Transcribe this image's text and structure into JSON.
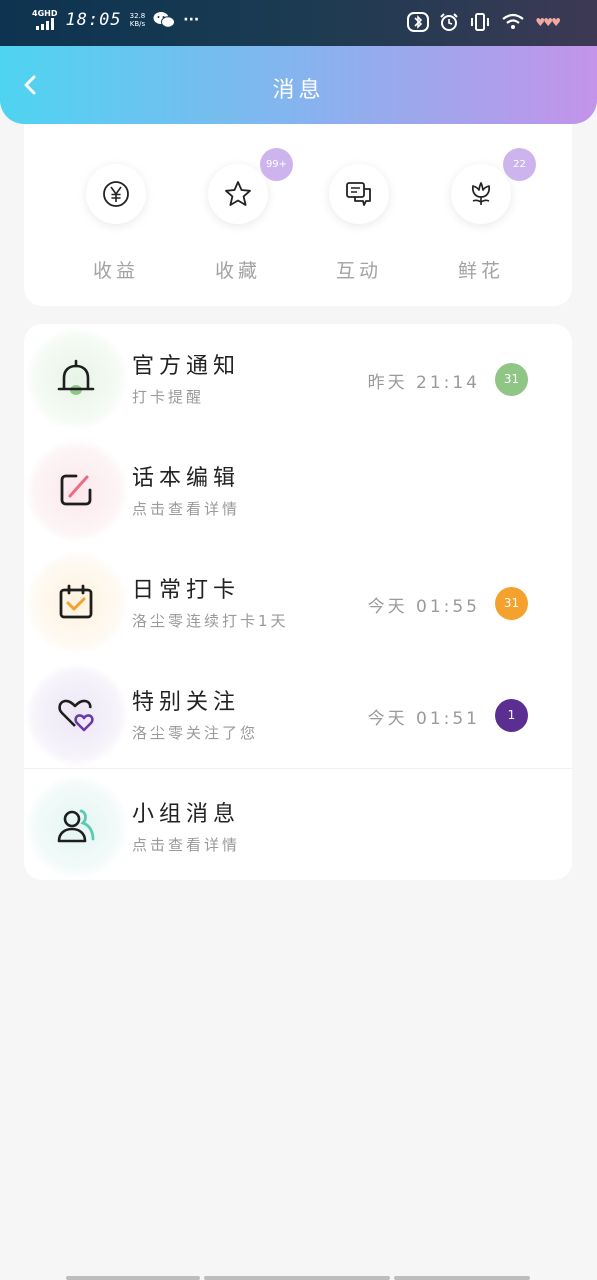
{
  "status_bar": {
    "network": "4GHD",
    "time": "18:05",
    "speed_value": "32.8",
    "speed_unit": "KB/s",
    "more": "···"
  },
  "header": {
    "title": "消息"
  },
  "quick": [
    {
      "label": "收益",
      "icon": "yen-icon",
      "badge": ""
    },
    {
      "label": "收藏",
      "icon": "star-icon",
      "badge": "99+"
    },
    {
      "label": "互动",
      "icon": "chat-icon",
      "badge": ""
    },
    {
      "label": "鲜花",
      "icon": "flower-icon",
      "badge": "22"
    }
  ],
  "messages": [
    {
      "title": "官方通知",
      "subtitle": "打卡提醒",
      "time": "昨天 21:14",
      "badge": "31",
      "icon": "bell-icon",
      "badge_color": "#8fc585",
      "glow": "#eef7ee"
    },
    {
      "title": "话本编辑",
      "subtitle": "点击查看详情",
      "time": "",
      "badge": "",
      "icon": "edit-icon",
      "glow": "#fcf0f2"
    },
    {
      "title": "日常打卡",
      "subtitle": "洛尘零连续打卡1天",
      "time": "今天 01:55",
      "badge": "31",
      "icon": "calendar-check-icon",
      "badge_color": "#f4a12e",
      "glow": "#fdf7ec"
    },
    {
      "title": "特别关注",
      "subtitle": "洛尘零关注了您",
      "time": "今天 01:51",
      "badge": "1",
      "icon": "hearts-icon",
      "badge_color": "#5b2e91",
      "glow": "#f4f1fa"
    },
    {
      "title": "小组消息",
      "subtitle": "点击查看详情",
      "time": "",
      "badge": "",
      "icon": "group-icon",
      "glow": "#eef9f7"
    }
  ],
  "colors": {
    "header_gradient": [
      "#4ed4f0",
      "#c393ea"
    ],
    "quick_badge": "#cdb4ec"
  }
}
